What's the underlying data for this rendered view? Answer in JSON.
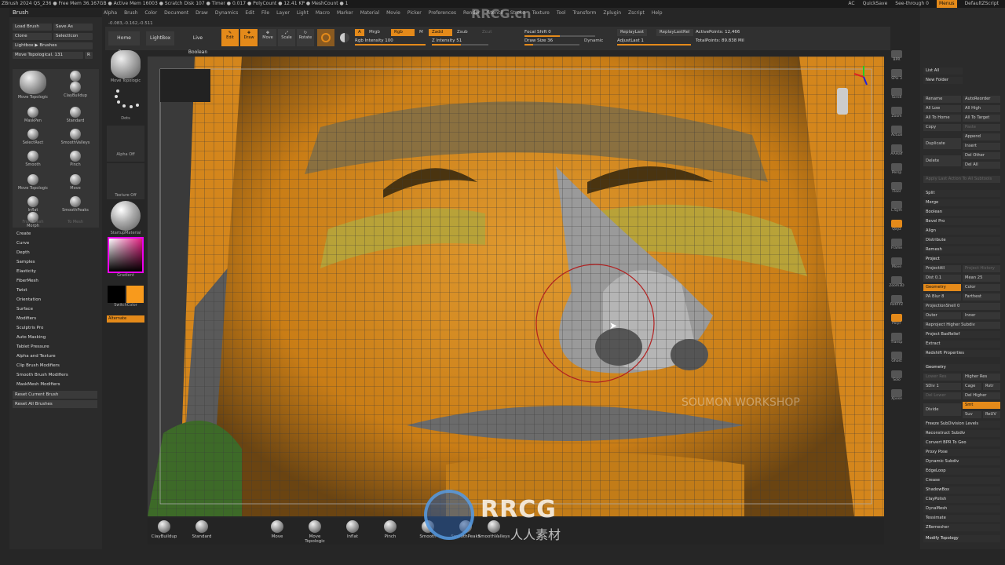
{
  "titlebar": {
    "text": "ZBrush 2024   QS_236   ● Free Mem 36.167GB ● Active Mem 16003 ● Scratch Disk 107 ● Timer ● 0.017 ● PolyCount ● 12.41 KP ● MeshCount ● 1",
    "ac": "AC",
    "quicksave": "QuickSave",
    "seethrough": "See-through  0",
    "menus": "Menus",
    "script": "DefaultZScript"
  },
  "topmenu": [
    "Alpha",
    "Brush",
    "Color",
    "Document",
    "Draw",
    "Dynamics",
    "Edit",
    "File",
    "Layer",
    "Light",
    "Macro",
    "Marker",
    "Material",
    "Movie",
    "Picker",
    "Preferences",
    "Render",
    "Stencil",
    "Stroke",
    "Texture",
    "Tool",
    "Transform",
    "Zplugin",
    "Zscript",
    "Help"
  ],
  "coords": "-0.083,-0.162,-0.511",
  "brushpanel": {
    "title": "Brush",
    "load": "Load Brush",
    "saveas": "Save As",
    "clone": "Clone",
    "selecticon": "SelectIcon",
    "lightbox": "Lightbox ▶ Brushes",
    "current": "Move Topological. 131",
    "current_key": "R",
    "brushes": [
      "Move Topologic",
      "Clay",
      "ClayBuildup",
      "MaskPen",
      "Standard",
      "SelectRect",
      "SmoothValleys",
      "Smooth",
      "Pinch",
      "Move Topologic",
      "Move",
      "Inflat",
      "SmoothPeaks",
      "Morph"
    ],
    "from_mesh": "From Mesh",
    "to_mesh": "To Mesh",
    "menu": [
      "Create",
      "Curve",
      "Depth",
      "Samples",
      "Elasticity",
      "FiberMesh",
      "Twist",
      "Orientation",
      "Surface",
      "Modifiers",
      "Sculptris Pro",
      "Auto Masking",
      "Tablet Pressure",
      "Alpha and Texture",
      "Clip Brush Modifiers",
      "Smooth Brush Modifiers",
      "MaskMesh Modifiers"
    ],
    "reset_current": "Reset Current Brush",
    "reset_all": "Reset All Brushes"
  },
  "shelf": {
    "home": "Home Page",
    "lightbox": "LightBox",
    "liveboolean": "Live Boolean",
    "edit": "Edit",
    "draw": "Draw",
    "move": "Move",
    "scale": "Scale",
    "rotate": "Rotate",
    "a": "A",
    "mrgb": "Mrgb",
    "rgb": "Rgb",
    "m": "M",
    "zadd": "Zadd",
    "zsub": "Zsub",
    "zcut": "Zcut",
    "rgb_intensity": "Rgb Intensity 100",
    "z_intensity": "Z Intensity 51",
    "focal_shift": "Focal Shift 0",
    "draw_size": "Draw Size 36",
    "dynamic": "Dynamic",
    "replaylast": "ReplayLast",
    "replaylastrel": "ReplayLastRel",
    "adjustlast": "AdjustLast 1",
    "activepoints": "ActivePoints: 12,466",
    "totalpoints": "TotalPoints: 89.838 Mil"
  },
  "sidecol": {
    "brush": "Move Topologic",
    "dots": "Dots",
    "alpha": "Alpha Off",
    "texture": "Texture Off",
    "material": "StartupMaterial",
    "gradient": "Gradient",
    "switchcolor": "SwitchColor",
    "alternate": "Alternate"
  },
  "righticons": [
    "BPR",
    "SPix 3",
    "Scroll",
    "Zoom",
    "Actual",
    "AAHalf",
    "Persp",
    "Floor",
    "L.Sym",
    "Qxyz",
    "Frame",
    "Move",
    "Zoom3D",
    "RotXYZ",
    "PolyF",
    "Transp",
    "Ghost",
    "Solo",
    "Xpose"
  ],
  "subtool": {
    "list_all": "List All",
    "new_folder": "New Folder",
    "rename": "Rename",
    "autoreorder": "AutoReorder",
    "all_low": "All Low",
    "all_high": "All High",
    "all_to_home": "All To Home",
    "all_to_target": "All To Target",
    "copy": "Copy",
    "paste": "Paste",
    "append": "Append",
    "duplicate": "Duplicate",
    "insert": "Insert",
    "delete": "Delete",
    "del_other": "Del Other",
    "del_all": "Del All",
    "apply_last": "Apply Last Action To All Subtools",
    "split": "Split",
    "merge": "Merge",
    "boolean": "Boolean",
    "bevel_pro": "Bevel Pro",
    "align": "Align",
    "distribute": "Distribute",
    "remesh": "Remesh",
    "project": "Project",
    "projectall": "ProjectAll",
    "project_history": "Project History",
    "dist": "Dist 0.1",
    "mean": "Mean 25",
    "geometry_btn": "Geometry",
    "color": "Color",
    "pa_blur": "PA Blur 8",
    "farthest": "Farthest",
    "projectionshell": "ProjectionShell 0",
    "outer": "Outer",
    "inner": "Inner",
    "reproject": "Reproject Higher Subdiv",
    "project_basrelief": "Project BasRelief",
    "extract": "Extract",
    "redshift": "Redshift Properties"
  },
  "geometry": {
    "title": "Geometry",
    "lower_res": "Lower Res",
    "higher_res": "Higher Res",
    "sdiv": "SDiv 1",
    "cage": "Cage",
    "rstr": "Rstr",
    "del_lower": "Del Lower",
    "del_higher": "Del Higher",
    "divide": "Divide",
    "smt": "Smt",
    "suv": "Suv",
    "reuv": "ReUV",
    "freeze": "Freeze SubDivision Levels",
    "reconstruct": "Reconstruct Subdiv",
    "convert_bpr": "Convert BPR To Geo",
    "proxy_pose": "Proxy Pose",
    "dynamic_subdiv": "Dynamic Subdiv",
    "edgeloop": "EdgeLoop",
    "crease": "Crease",
    "shadowbox": "ShadowBox",
    "claypolish": "ClayPolish",
    "dynamesh": "DynaMesh",
    "tessimate": "Tessimate",
    "zremesher": "ZRemesher",
    "modify_topology": "Modify Topology"
  },
  "bottombar": [
    "ClayBuildup",
    "Standard",
    "Move",
    "Move Topologic",
    "Inflat",
    "Pinch",
    "Smooth",
    "SmoothPeaks",
    "SmoothValleys"
  ],
  "watermark": {
    "brand": "RRCG",
    "sub": "人人素材",
    "top": "RRCG.cn",
    "logo": "SOUMON WORKSHOP"
  },
  "colors": {
    "accent": "#e48a1a",
    "panel": "#2b2b2b",
    "mesh_orange": "#d98a1c",
    "mesh_gray": "#7a7a7a"
  }
}
